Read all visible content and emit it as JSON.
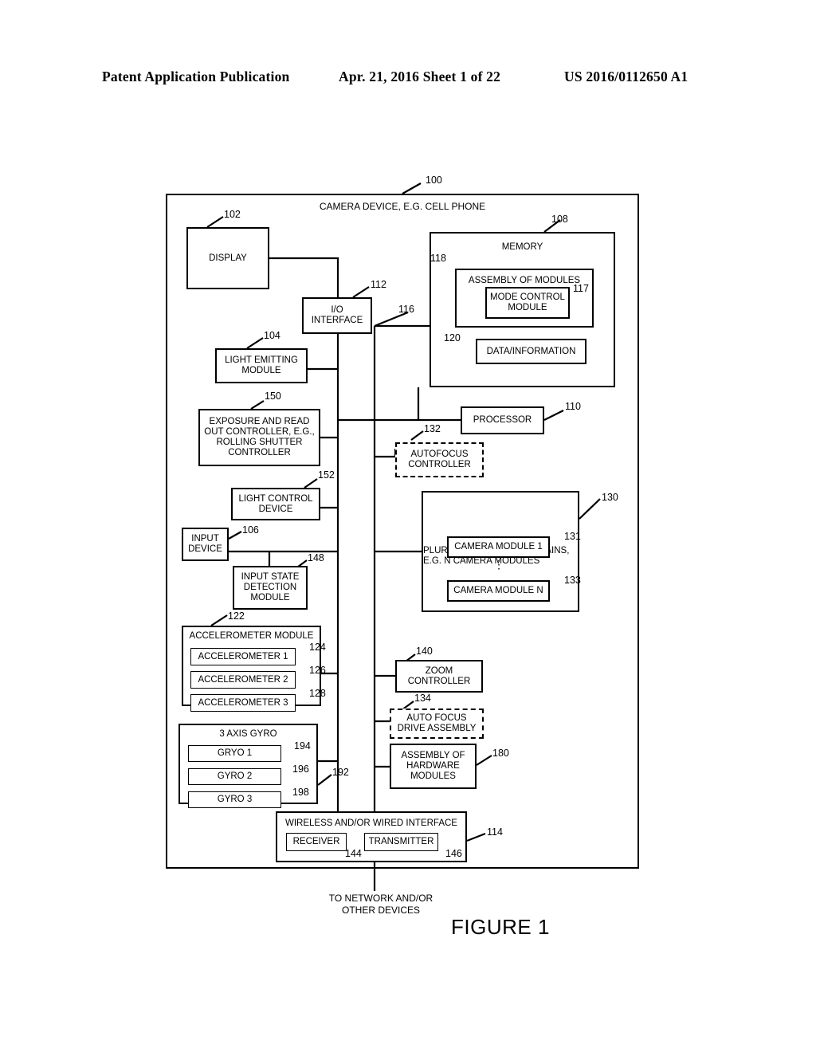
{
  "page_header": {
    "publication": "Patent Application Publication",
    "date_sheet": "Apr. 21, 2016  Sheet 1 of 22",
    "pub_number": "US 2016/0112650 A1"
  },
  "figure": {
    "caption": "FIGURE 1",
    "device_title": "CAMERA DEVICE, E.G. CELL PHONE",
    "device_ref": "100",
    "network_note_line1": "TO NETWORK AND/OR",
    "network_note_line2": "OTHER DEVICES"
  },
  "blocks": {
    "display": {
      "label": "DISPLAY",
      "ref": "102"
    },
    "light_emitting": {
      "line1": "LIGHT EMITTING",
      "line2": "MODULE",
      "ref": "104"
    },
    "io_interface": {
      "line1": "I/O",
      "line2": "INTERFACE",
      "ref": "112"
    },
    "memory": {
      "label": "MEMORY",
      "ref": "108"
    },
    "assembly_of_modules": {
      "label": "ASSEMBLY OF MODULES",
      "ref": "118"
    },
    "mode_control_module": {
      "line1": "MODE CONTROL",
      "line2": "MODULE",
      "ref": "117"
    },
    "data_information": {
      "label": "DATA/INFORMATION",
      "ref": "120"
    },
    "bus": {
      "ref": "116"
    },
    "exposure_controller": {
      "line1": "EXPOSURE AND READ",
      "line2": "OUT CONTROLLER, E.G.,",
      "line3": "ROLLING SHUTTER",
      "line4": "CONTROLLER",
      "ref": "150"
    },
    "processor": {
      "label": "PROCESSOR",
      "ref": "110"
    },
    "autofocus_controller": {
      "line1": "AUTOFOCUS",
      "line2": "CONTROLLER",
      "ref": "132"
    },
    "light_control_device": {
      "line1": "LIGHT CONTROL",
      "line2": "DEVICE",
      "ref": "152"
    },
    "optical_chains": {
      "line1": "PLURALITY OF OPTICAL CHAINS,",
      "line2": "E.G. N CAMERA MODULES",
      "ref": "130"
    },
    "camera_module_1": {
      "label": "CAMERA MODULE 1",
      "ref": "131"
    },
    "camera_module_n": {
      "label": "CAMERA MODULE N",
      "ref": "133"
    },
    "input_device": {
      "line1": "INPUT",
      "line2": "DEVICE",
      "ref": "106"
    },
    "input_state_module": {
      "line1": "INPUT STATE",
      "line2": "DETECTION",
      "line3": "MODULE",
      "ref": "148"
    },
    "accelerometer_module": {
      "label": "ACCELEROMETER MODULE",
      "ref": "122"
    },
    "accelerometer_1": {
      "label": "ACCELEROMETER 1",
      "ref": "124"
    },
    "accelerometer_2": {
      "label": "ACCELEROMETER 2",
      "ref": "126"
    },
    "accelerometer_3": {
      "label": "ACCELEROMETER 3",
      "ref": "128"
    },
    "gyro_module": {
      "label": "3 AXIS GYRO",
      "ref": "192"
    },
    "gyro_1": {
      "label": "GRYO 1",
      "ref": "194"
    },
    "gyro_2": {
      "label": "GYRO 2",
      "ref": "196"
    },
    "gyro_3": {
      "label": "GYRO  3",
      "ref": "198"
    },
    "zoom_controller": {
      "line1": "ZOOM",
      "line2": "CONTROLLER",
      "ref": "140"
    },
    "auto_focus_drive": {
      "line1": "AUTO FOCUS",
      "line2": "DRIVE ASSEMBLY",
      "ref": "134"
    },
    "hardware_modules": {
      "line1": "ASSEMBLY OF",
      "line2": "HARDWARE",
      "line3": "MODULES",
      "ref": "180"
    },
    "wireless_interface": {
      "label": "WIRELESS AND/OR WIRED INTERFACE",
      "ref": "114"
    },
    "receiver": {
      "label": "RECEIVER",
      "ref": "144"
    },
    "transmitter": {
      "label": "TRANSMITTER",
      "ref": "146"
    },
    "ellipsis": {
      "label": "⋮"
    }
  },
  "colors": {
    "ink": "#000000",
    "paper": "#ffffff"
  }
}
